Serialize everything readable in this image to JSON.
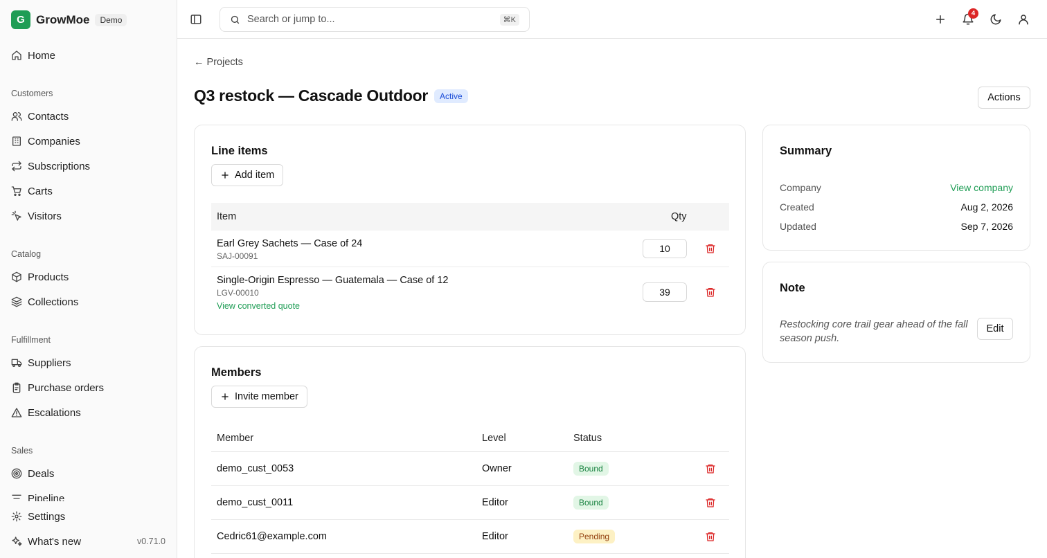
{
  "app": {
    "name": "GrowMoe",
    "logo_letter": "G",
    "badge": "Demo",
    "version": "v0.71.0"
  },
  "sidebar": {
    "home": "Home",
    "sections": {
      "customers": "Customers",
      "catalog": "Catalog",
      "fulfillment": "Fulfillment",
      "sales": "Sales"
    },
    "items": {
      "contacts": "Contacts",
      "companies": "Companies",
      "subscriptions": "Subscriptions",
      "carts": "Carts",
      "visitors": "Visitors",
      "products": "Products",
      "collections": "Collections",
      "suppliers": "Suppliers",
      "purchase_orders": "Purchase orders",
      "escalations": "Escalations",
      "deals": "Deals",
      "pipeline": "Pipeline",
      "settings": "Settings",
      "whats_new": "What's new"
    }
  },
  "topbar": {
    "search_placeholder": "Search or jump to...",
    "search_shortcut": "⌘K",
    "notification_count": "4"
  },
  "page": {
    "back_label": "← Projects",
    "title": "Q3 restock — Cascade Outdoor",
    "status": "Active",
    "actions_label": "Actions"
  },
  "line_items": {
    "title": "Line items",
    "add_label": "Add item",
    "col_item": "Item",
    "col_qty": "Qty",
    "rows": [
      {
        "name": "Earl Grey Sachets — Case of 24",
        "sku": "SAJ-00091",
        "qty": "10"
      },
      {
        "name": "Single-Origin Espresso — Guatemala — Case of 12",
        "sku": "LGV-00010",
        "qty": "39",
        "link": "View converted quote"
      }
    ]
  },
  "members": {
    "title": "Members",
    "invite_label": "Invite member",
    "col_member": "Member",
    "col_level": "Level",
    "col_status": "Status",
    "rows": [
      {
        "member": "demo_cust_0053",
        "level": "Owner",
        "status": "Bound"
      },
      {
        "member": "demo_cust_0011",
        "level": "Editor",
        "status": "Bound"
      },
      {
        "member": "Cedric61@example.com",
        "level": "Editor",
        "status": "Pending"
      }
    ]
  },
  "summary": {
    "title": "Summary",
    "company_label": "Company",
    "company_value": "View company",
    "created_label": "Created",
    "created_value": "Aug 2, 2026",
    "updated_label": "Updated",
    "updated_value": "Sep 7, 2026"
  },
  "note": {
    "title": "Note",
    "text": "Restocking core trail gear ahead of the fall season push.",
    "edit_label": "Edit"
  },
  "colors": {
    "brand": "#1f9d55",
    "danger": "#dc2626",
    "active_badge": "#1d4ed8"
  }
}
